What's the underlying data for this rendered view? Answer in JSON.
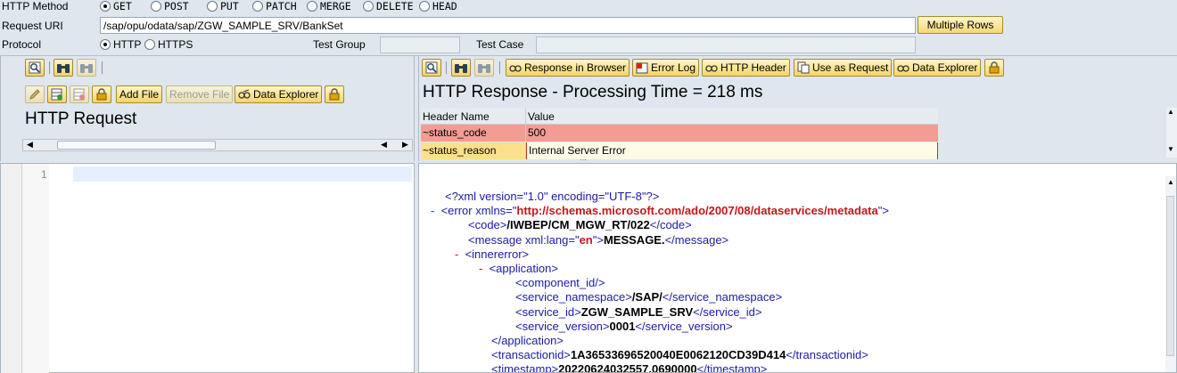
{
  "form": {
    "http_method_label": "HTTP Method",
    "methods": [
      {
        "label": "GET",
        "selected": true
      },
      {
        "label": "POST",
        "selected": false
      },
      {
        "label": "PUT",
        "selected": false
      },
      {
        "label": "PATCH",
        "selected": false
      },
      {
        "label": "MERGE",
        "selected": false
      },
      {
        "label": "DELETE",
        "selected": false
      },
      {
        "label": "HEAD",
        "selected": false
      }
    ],
    "request_uri_label": "Request URI",
    "request_uri_value": "/sap/opu/odata/sap/ZGW_SAMPLE_SRV/BankSet",
    "multiple_rows_label": "Multiple Rows",
    "protocol_label": "Protocol",
    "protocols": [
      {
        "label": "HTTP",
        "selected": true
      },
      {
        "label": "HTTPS",
        "selected": false
      }
    ],
    "test_group_label": "Test Group",
    "test_group_value": "",
    "test_case_label": "Test Case",
    "test_case_value": ""
  },
  "request_pane": {
    "add_file_label": "Add File",
    "remove_file_label": "Remove File",
    "data_explorer_label": "Data Explorer",
    "title": "HTTP Request",
    "editor_line_number": "1"
  },
  "response_pane": {
    "toolbar": {
      "response_in_browser": "Response in Browser",
      "error_log": "Error Log",
      "http_header": "HTTP Header",
      "use_as_request": "Use as Request",
      "data_explorer": "Data Explorer"
    },
    "title": "HTTP Response - Processing Time = 218  ms",
    "header_table": {
      "col_name": "Header Name",
      "col_value": "Value",
      "rows": [
        {
          "name": "~status_code",
          "value": "500"
        },
        {
          "name": "~status_reason",
          "value": "Internal Server Error"
        }
      ]
    },
    "xml": {
      "decl": "<?xml version=\"1.0\" encoding=\"UTF-8\"?>",
      "error_open_tag": "<error xmlns=\"",
      "error_ns": "http://schemas.microsoft.com/ado/2007/08/dataservices/metadata",
      "error_open_close": "\">",
      "code_open": "<code>",
      "code_value": "/IWBEP/CM_MGW_RT/022",
      "code_close": "</code>",
      "message_open": "<message xml:lang=\"",
      "message_lang": "en",
      "message_mid": "\">",
      "message_value": "MESSAGE.",
      "message_close": "</message>",
      "innererror_open": "<innererror>",
      "application_open": "<application>",
      "component_id": "<component_id/>",
      "service_namespace_open": "<service_namespace>",
      "service_namespace_value": "/SAP/",
      "service_namespace_close": "</service_namespace>",
      "service_id_open": "<service_id>",
      "service_id_value": "ZGW_SAMPLE_SRV",
      "service_id_close": "</service_id>",
      "service_version_open": "<service_version>",
      "service_version_value": "0001",
      "service_version_close": "</service_version>",
      "application_close": "</application>",
      "transactionid_open": "<transactionid>",
      "transactionid_value": "1A36533696520040E0062120CD39D414",
      "transactionid_close": "</transactionid>",
      "timestamp_open": "<timestamp>",
      "timestamp_value": "20220624032557.0690000",
      "timestamp_close": "</timestamp>",
      "collapse_marker": "-"
    }
  },
  "colors": {
    "status_code_row": "#f39c94",
    "status_reason_row": "#fde18a",
    "toolbar_button": "#f5d875",
    "xml_tag": "#1a1aa6",
    "xml_value": "#c4161c"
  }
}
